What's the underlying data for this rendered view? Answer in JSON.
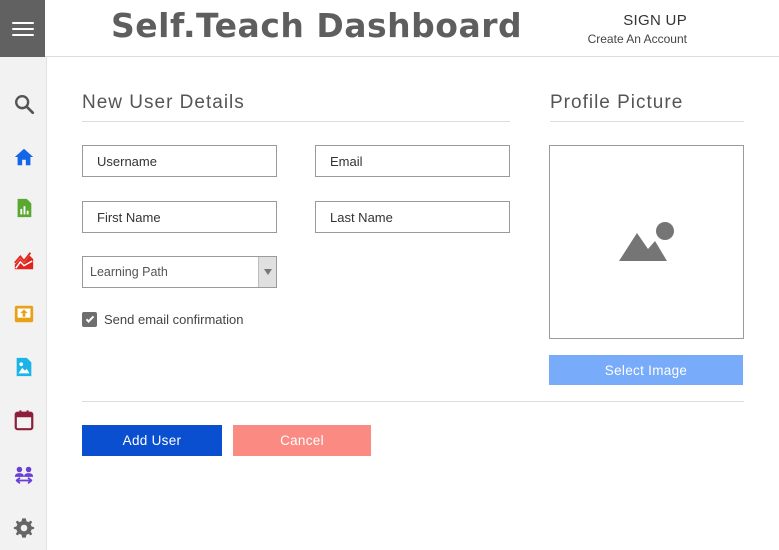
{
  "header": {
    "title": "Self.Teach Dashboard",
    "signup_label": "SIGN UP",
    "signup_sub": "Create An Account"
  },
  "sidebar": {
    "items": [
      {
        "icon": "search-icon",
        "color": "#555555"
      },
      {
        "icon": "home-icon",
        "color": "#1565e8"
      },
      {
        "icon": "report-icon",
        "color": "#5aa832"
      },
      {
        "icon": "chart-icon",
        "color": "#e0261c"
      },
      {
        "icon": "upload-box-icon",
        "color": "#e8a21a"
      },
      {
        "icon": "image-file-icon",
        "color": "#1ab4e8"
      },
      {
        "icon": "calendar-icon",
        "color": "#8e1f3a"
      },
      {
        "icon": "group-icon",
        "color": "#6a3fd6"
      },
      {
        "icon": "gear-icon",
        "color": "#666666"
      }
    ]
  },
  "form": {
    "section_title": "New User Details",
    "username_placeholder": "Username",
    "email_placeholder": "Email",
    "firstname_placeholder": "First Name",
    "lastname_placeholder": "Last Name",
    "learning_path": "Learning Path",
    "send_email_label": "Send email confirmation",
    "send_email_checked": true
  },
  "profile": {
    "section_title": "Profile Picture",
    "select_image_label": "Select Image"
  },
  "actions": {
    "add_user_label": "Add User",
    "cancel_label": "Cancel"
  },
  "colors": {
    "add_user": "#0a4fcf",
    "cancel": "#fa8a82",
    "select_image": "#78abfa",
    "menu_button": "#616161"
  }
}
